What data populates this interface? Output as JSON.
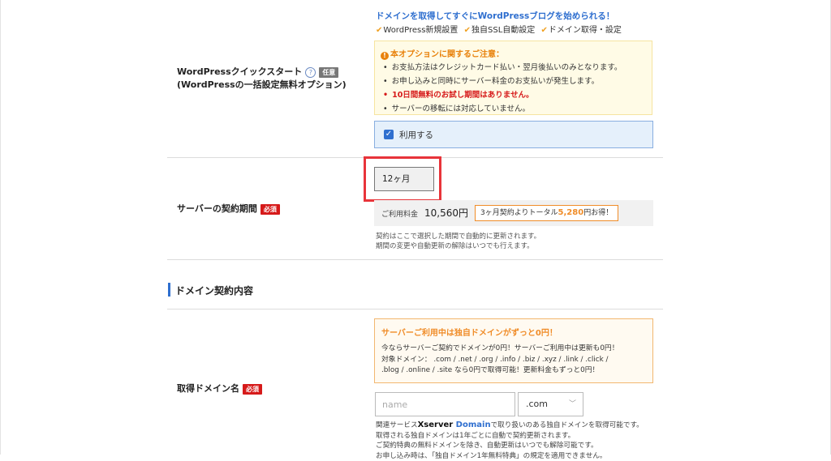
{
  "wp_quick_start": {
    "label_line1": "WordPressクイックスタート",
    "badge_optional": "任意",
    "label_line2": "(WordPressの一括設定無料オプション)",
    "promo_title": "ドメインを取得してすぐにWordPressブログを始められる！",
    "promo_checks": [
      "WordPress新規設置",
      "独自SSL自動設定",
      "ドメイン取得・設定"
    ],
    "notice_title": "本オプションに関するご注意：",
    "notices": [
      "お支払方法はクレジットカード払い・翌月後払いのみとなります。",
      "お申し込みと同時にサーバー料金のお支払いが発生します。",
      "10日間無料のお試し期間はありません。",
      "サーバーの移転には対応していません。"
    ],
    "use_label": "利用する",
    "use_checked": true
  },
  "server_period": {
    "label": "サーバーの契約期間",
    "badge_required": "必須",
    "selected": "12ヶ月",
    "price_label": "ご利用料金",
    "price_value": "10,560円",
    "deal_prefix": "3ヶ月契約よりトータル",
    "deal_amount": "5,280",
    "deal_suffix": "円お得！",
    "note_line1": "契約はここで選択した期間で自動的に更新されます。",
    "note_line2": "期間の変更や自動更新の解除はいつでも行えます。"
  },
  "section": {
    "title": "ドメイン契約内容"
  },
  "domain": {
    "label": "取得ドメイン名",
    "badge_required": "必須",
    "free_title": "サーバーご利用中は独自ドメインがずっと0円！",
    "free_line1": "今ならサーバーご契約でドメインが0円！サーバーご利用中は更新も0円！",
    "free_line2": "対象ドメイン： .com / .net / .org / .info / .biz / .xyz / .link / .click /",
    "free_line3": ".blog / .online / .site なら0円で取得可能！更新料金もずっと0円！",
    "input_placeholder": "name",
    "input_value": "",
    "tld_selected": ".com",
    "note1_prefix": "関連サービス",
    "brand_a": "Xserver",
    "brand_b": "Domain",
    "note1_suffix": "で取り扱いのある独自ドメインを取得可能です。",
    "note2": "取得される独自ドメインは1年ごとに自動で契約更新されます。",
    "note3": "ご契約特典の無料ドメインを除き、自動更新はいつでも解除可能です。",
    "note4": "お申し込み時は、「独自ドメイン1年無料特典」の規定を適用できません。"
  },
  "icons": {
    "check": "check-icon",
    "help": "help-icon",
    "notice": "exclamation-icon",
    "chevron": "chevron-down-icon"
  },
  "colors": {
    "accent_blue": "#2f6fcf",
    "required_red": "#d61a1a",
    "highlight_orange": "#f08c28",
    "annotation_red": "#e8343a"
  }
}
